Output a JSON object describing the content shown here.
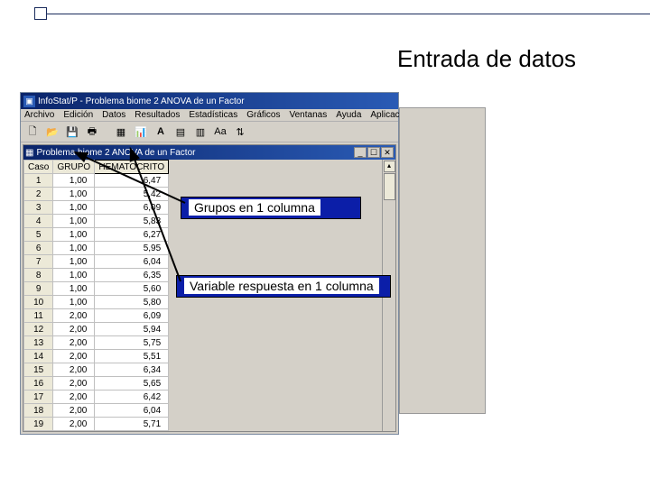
{
  "slide": {
    "title": "Entrada de datos"
  },
  "app": {
    "title": "InfoStat/P - Problema biome 2 ANOVA de un Factor",
    "menu": [
      "Archivo",
      "Edición",
      "Datos",
      "Resultados",
      "Estadísticas",
      "Gráficos",
      "Ventanas",
      "Ayuda",
      "Aplicaciones"
    ],
    "doc_title": "Problema biome 2 ANOVA de un Factor",
    "columns": {
      "case": "Caso",
      "a": "GRUPO",
      "b": "HEMATOCRITO"
    },
    "rows": [
      {
        "n": "1",
        "g": "1,00",
        "h": "6,47"
      },
      {
        "n": "2",
        "g": "1,00",
        "h": "5,42"
      },
      {
        "n": "3",
        "g": "1,00",
        "h": "6,09"
      },
      {
        "n": "4",
        "g": "1,00",
        "h": "5,83"
      },
      {
        "n": "5",
        "g": "1,00",
        "h": "6,27"
      },
      {
        "n": "6",
        "g": "1,00",
        "h": "5,95"
      },
      {
        "n": "7",
        "g": "1,00",
        "h": "6,04"
      },
      {
        "n": "8",
        "g": "1,00",
        "h": "6,35"
      },
      {
        "n": "9",
        "g": "1,00",
        "h": "5,60"
      },
      {
        "n": "10",
        "g": "1,00",
        "h": "5,80"
      },
      {
        "n": "11",
        "g": "2,00",
        "h": "6,09"
      },
      {
        "n": "12",
        "g": "2,00",
        "h": "5,94"
      },
      {
        "n": "13",
        "g": "2,00",
        "h": "5,75"
      },
      {
        "n": "14",
        "g": "2,00",
        "h": "5,51"
      },
      {
        "n": "15",
        "g": "2,00",
        "h": "6,34"
      },
      {
        "n": "16",
        "g": "2,00",
        "h": "5,65"
      },
      {
        "n": "17",
        "g": "2,00",
        "h": "6,42"
      },
      {
        "n": "18",
        "g": "2,00",
        "h": "6,04"
      },
      {
        "n": "19",
        "g": "2,00",
        "h": "5,71"
      }
    ]
  },
  "callouts": {
    "c1": "Grupos en 1 columna",
    "c2": "Variable respuesta en 1 columna"
  }
}
